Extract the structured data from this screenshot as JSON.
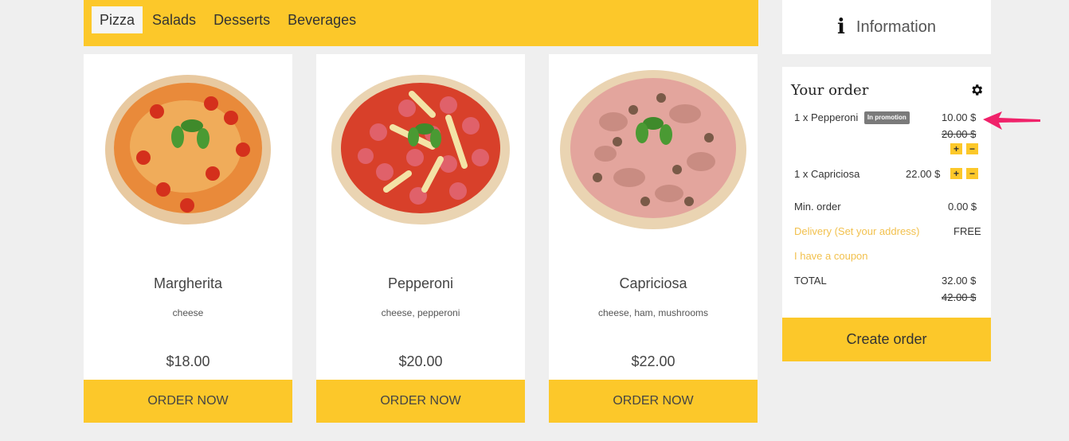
{
  "tabs": [
    {
      "label": "Pizza"
    },
    {
      "label": "Salads"
    },
    {
      "label": "Desserts"
    },
    {
      "label": "Beverages"
    }
  ],
  "products": [
    {
      "name": "Margherita",
      "description": "cheese",
      "price": "$18.00",
      "button": "ORDER NOW"
    },
    {
      "name": "Pepperoni",
      "description": "cheese, pepperoni",
      "price": "$20.00",
      "button": "ORDER NOW"
    },
    {
      "name": "Capriciosa",
      "description": "cheese, ham, mushrooms",
      "price": "$22.00",
      "button": "ORDER NOW"
    }
  ],
  "info": {
    "label": "Information"
  },
  "order": {
    "title": "Your order",
    "items": [
      {
        "name": "1 x Pepperoni",
        "badge": "In promotion",
        "price": "10.00 $",
        "old_price": "20.00 $",
        "plus": "+",
        "minus": "−"
      },
      {
        "name": "1 x Capriciosa",
        "price": "22.00 $",
        "plus": "+",
        "minus": "−"
      }
    ],
    "min_order_label": "Min. order",
    "min_order_value": "0.00 $",
    "delivery_label": "Delivery (Set your address)",
    "delivery_value": "FREE",
    "coupon_label": "I have a coupon",
    "total_label": "TOTAL",
    "total_value": "32.00 $",
    "total_old": "42.00 $"
  },
  "create_order": "Create order",
  "colors": {
    "accent": "#fcc82a",
    "link": "#f2c14e",
    "arrow": "#f0226a"
  }
}
